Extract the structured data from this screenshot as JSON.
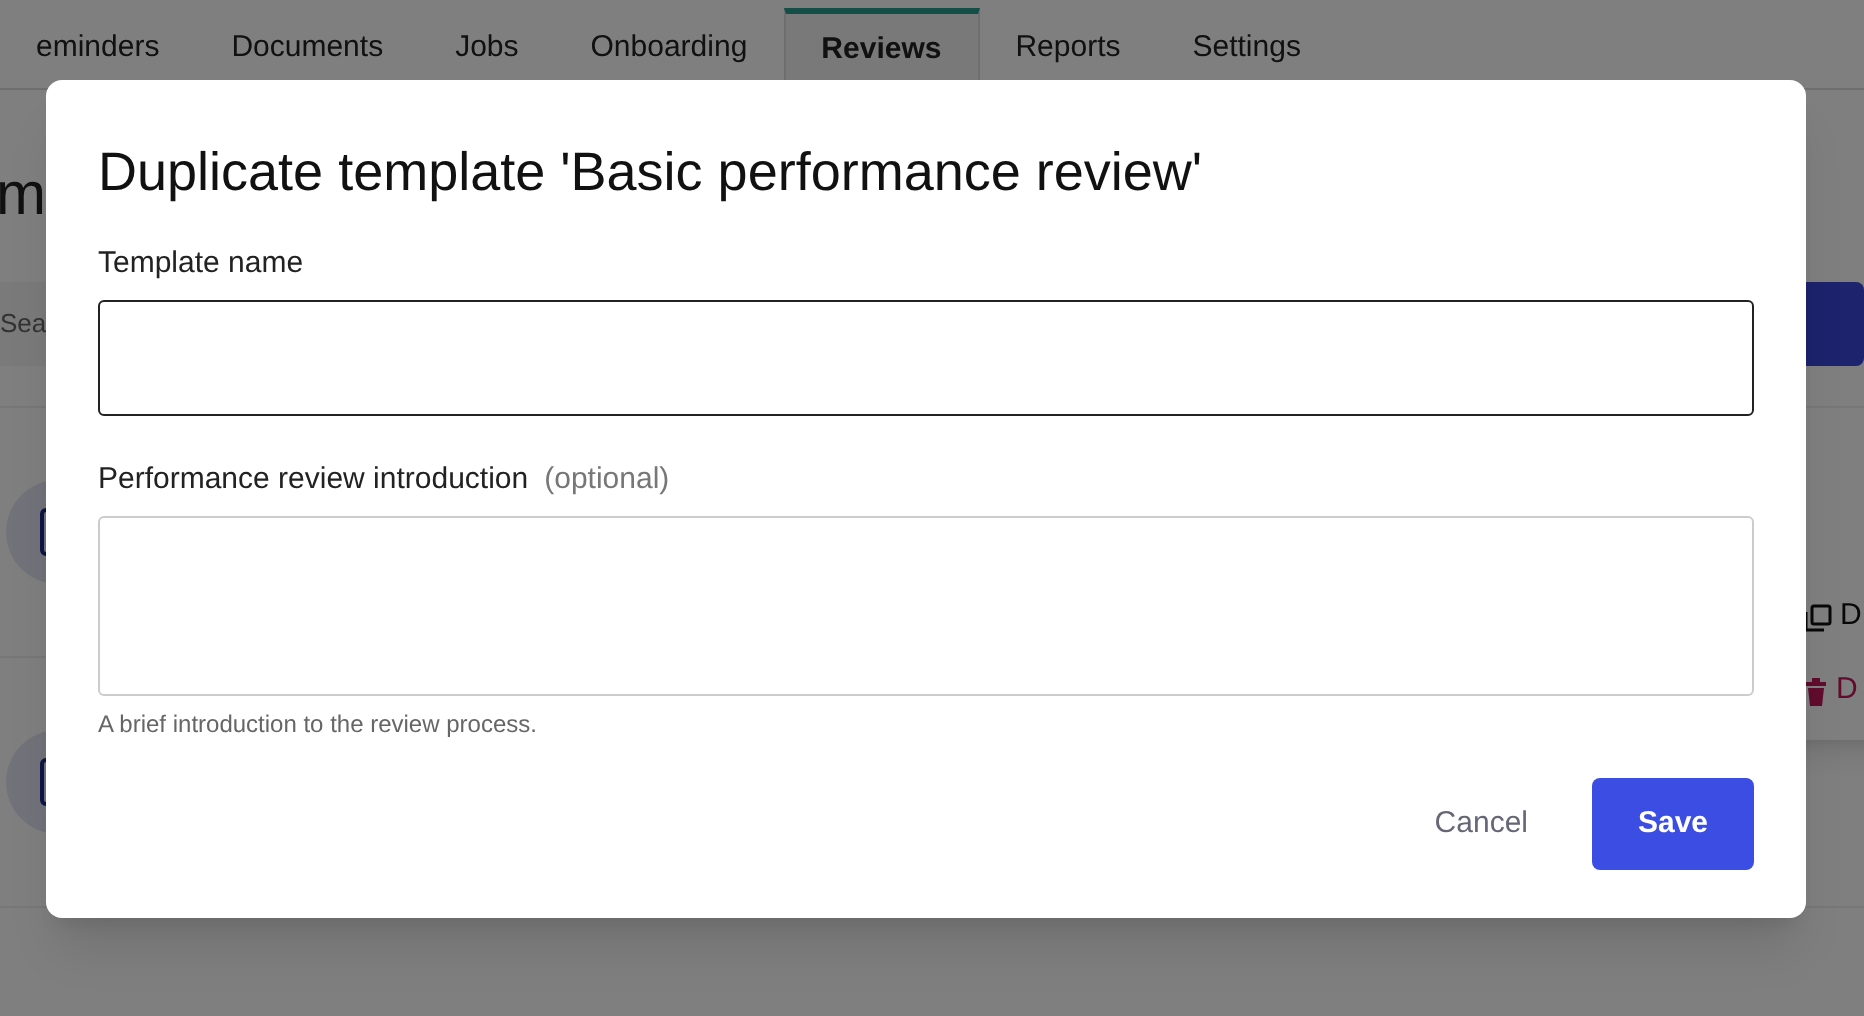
{
  "tabs": [
    {
      "label": "eminders",
      "selected": false
    },
    {
      "label": "Documents",
      "selected": false
    },
    {
      "label": "Jobs",
      "selected": false
    },
    {
      "label": "Onboarding",
      "selected": false
    },
    {
      "label": "Reviews",
      "selected": true
    },
    {
      "label": "Reports",
      "selected": false
    },
    {
      "label": "Settings",
      "selected": false
    }
  ],
  "page_heading": "m",
  "search": {
    "placeholder": "Sea"
  },
  "row_menu": [
    {
      "label": "D",
      "kind": "duplicate"
    },
    {
      "label": "D",
      "kind": "delete"
    }
  ],
  "dialog": {
    "title": "Duplicate template 'Basic performance review'",
    "fields": [
      {
        "label": "Template name",
        "kind": "input"
      },
      {
        "label": "Performance review introduction",
        "optional": "(optional)",
        "kind": "textarea",
        "hint": "A brief introduction to the review process."
      }
    ],
    "buttons": [
      {
        "label": "Cancel",
        "kind": "secondary"
      },
      {
        "label": "Save",
        "kind": "primary"
      }
    ]
  }
}
